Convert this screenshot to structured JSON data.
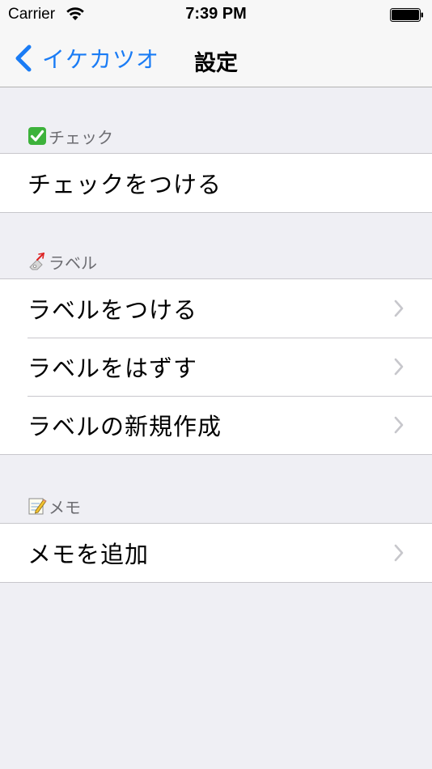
{
  "status_bar": {
    "carrier": "Carrier",
    "time": "7:39 PM"
  },
  "nav": {
    "back_label": "イケカツオ",
    "title": "設定"
  },
  "sections": [
    {
      "header": "チェック",
      "icon": "check-mark-icon",
      "rows": [
        {
          "label": "チェックをつける",
          "disclosure": false
        }
      ]
    },
    {
      "header": "ラベル",
      "icon": "label-tag-icon",
      "rows": [
        {
          "label": "ラベルをつける",
          "disclosure": true
        },
        {
          "label": "ラベルをはずす",
          "disclosure": true
        },
        {
          "label": "ラベルの新規作成",
          "disclosure": true
        }
      ]
    },
    {
      "header": "メモ",
      "icon": "memo-icon",
      "rows": [
        {
          "label": "メモを追加",
          "disclosure": true
        }
      ]
    }
  ],
  "colors": {
    "accent": "#1a7cf5",
    "background": "#efeff4",
    "header_text": "#6d6d72",
    "separator": "#c8c7cc",
    "check_green": "#3db23b"
  }
}
